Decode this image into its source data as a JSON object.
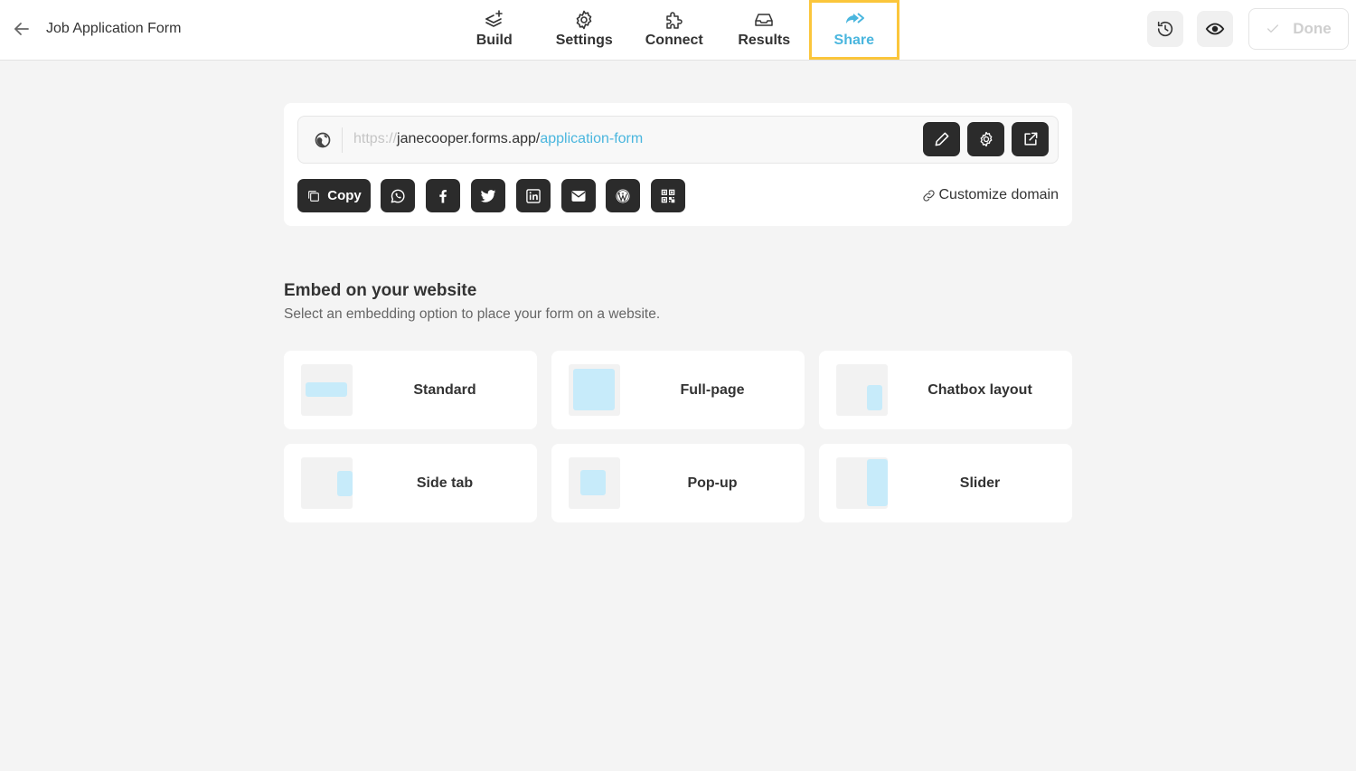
{
  "header": {
    "back_label": "Back",
    "title": "Job Application Form",
    "tabs": [
      {
        "label": "Build",
        "icon": "layers-plus-icon",
        "active": false
      },
      {
        "label": "Settings",
        "icon": "gear-icon",
        "active": false
      },
      {
        "label": "Connect",
        "icon": "puzzle-icon",
        "active": false
      },
      {
        "label": "Results",
        "icon": "inbox-icon",
        "active": false
      },
      {
        "label": "Share",
        "icon": "share-arrow-icon",
        "active": true
      }
    ],
    "history_icon": "history-icon",
    "preview_icon": "eye-icon",
    "done_label": "Done"
  },
  "share": {
    "url": {
      "protocol": "https://",
      "domain": "janecooper.forms.app/",
      "slug": "application-form"
    },
    "url_actions": [
      "edit-pencil-icon",
      "gear-icon",
      "external-link-icon"
    ],
    "copy_label": "Copy",
    "social_buttons": [
      "whatsapp-icon",
      "facebook-icon",
      "twitter-icon",
      "linkedin-icon",
      "email-icon",
      "wordpress-icon",
      "qr-code-icon"
    ],
    "customize_domain_label": "Customize domain"
  },
  "embed": {
    "title": "Embed on your website",
    "subtitle": "Select an embedding option to place your form on a website.",
    "options": [
      {
        "label": "Standard"
      },
      {
        "label": "Full-page"
      },
      {
        "label": "Chatbox layout"
      },
      {
        "label": "Side tab"
      },
      {
        "label": "Pop-up"
      },
      {
        "label": "Slider"
      }
    ]
  },
  "colors": {
    "accent": "#4ab6de",
    "highlight_border": "#fbc63b",
    "dark_button": "#2b2b2b",
    "thumb_fill": "#c7ebfa"
  }
}
